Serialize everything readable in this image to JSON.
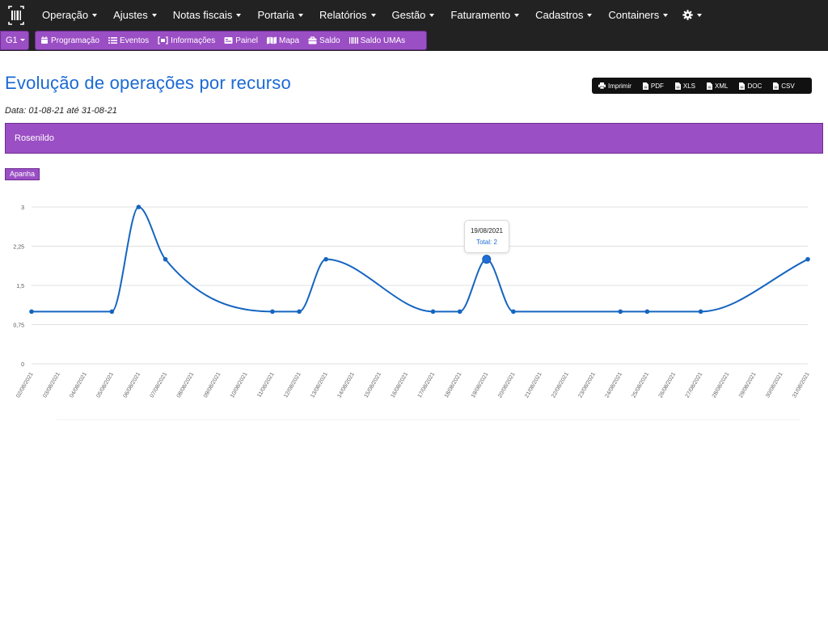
{
  "nav": {
    "items": [
      {
        "label": "Operação",
        "dropdown": true
      },
      {
        "label": "Ajustes",
        "dropdown": true
      },
      {
        "label": "Notas fiscais",
        "dropdown": true
      },
      {
        "label": "Portaria",
        "dropdown": true
      },
      {
        "label": "Relatórios",
        "dropdown": true
      },
      {
        "label": "Gestão",
        "dropdown": true
      },
      {
        "label": "Faturamento",
        "dropdown": true
      },
      {
        "label": "Cadastros",
        "dropdown": true
      },
      {
        "label": "Containers",
        "dropdown": true
      }
    ],
    "settings_icon": "gear-icon"
  },
  "subnav": {
    "unit_label": "G1",
    "items": [
      {
        "label": "Programação",
        "icon": "calendar-icon"
      },
      {
        "label": "Eventos",
        "icon": "list-icon"
      },
      {
        "label": "Informações",
        "icon": "info-frame-icon"
      },
      {
        "label": "Painel",
        "icon": "panel-icon"
      },
      {
        "label": "Mapa",
        "icon": "map-icon"
      },
      {
        "label": "Saldo",
        "icon": "briefcase-icon"
      },
      {
        "label": "Saldo UMAs",
        "icon": "barcode-icon"
      }
    ]
  },
  "page": {
    "title": "Evolução de operações por recurso",
    "date_range": "Data: 01-08-21 até 31-08-21",
    "resource_name": "Rosenildo",
    "activity_label": "Apanha"
  },
  "export": [
    {
      "label": "Imprimir",
      "icon": "printer-icon"
    },
    {
      "label": "PDF",
      "icon": "file-icon"
    },
    {
      "label": "XLS",
      "icon": "file-icon"
    },
    {
      "label": "XML",
      "icon": "file-icon"
    },
    {
      "label": "DOC",
      "icon": "file-icon"
    },
    {
      "label": "CSV",
      "icon": "file-icon"
    }
  ],
  "tooltip": {
    "date": "19/08/2021",
    "total": "Total: 2"
  },
  "colors": {
    "nav_bg": "#222222",
    "accent_purple": "#9b4fc4",
    "title_blue": "#1b6ad3",
    "series_line": "#1565c0",
    "grid": "#e0e0e0"
  },
  "chart_data": {
    "type": "line",
    "y_ticks": [
      "3",
      "2,25",
      "1,5",
      "0,75",
      "0"
    ],
    "ylim": [
      0,
      3
    ],
    "x": [
      "02/08/2021",
      "03/08/2021",
      "04/08/2021",
      "05/08/2021",
      "06/08/2021",
      "07/08/2021",
      "08/08/2021",
      "09/08/2021",
      "10/08/2021",
      "11/08/2021",
      "12/08/2021",
      "13/08/2021",
      "14/08/2021",
      "15/08/2021",
      "16/08/2021",
      "17/08/2021",
      "18/08/2021",
      "19/08/2021",
      "20/08/2021",
      "21/08/2021",
      "22/08/2021",
      "23/08/2021",
      "24/08/2021",
      "25/08/2021",
      "26/08/2021",
      "27/08/2021",
      "28/08/2021",
      "29/08/2021",
      "30/08/2021",
      "31/08/2021"
    ],
    "points": [
      {
        "x": "02/08/2021",
        "y": 1
      },
      {
        "x": "05/08/2021",
        "y": 1
      },
      {
        "x": "06/08/2021",
        "y": 3
      },
      {
        "x": "07/08/2021",
        "y": 2
      },
      {
        "x": "11/08/2021",
        "y": 1
      },
      {
        "x": "12/08/2021",
        "y": 1
      },
      {
        "x": "13/08/2021",
        "y": 2
      },
      {
        "x": "17/08/2021",
        "y": 1
      },
      {
        "x": "18/08/2021",
        "y": 1
      },
      {
        "x": "19/08/2021",
        "y": 2
      },
      {
        "x": "20/08/2021",
        "y": 1
      },
      {
        "x": "24/08/2021",
        "y": 1
      },
      {
        "x": "25/08/2021",
        "y": 1
      },
      {
        "x": "27/08/2021",
        "y": 1
      },
      {
        "x": "31/08/2021",
        "y": 2
      }
    ],
    "highlighted": "19/08/2021",
    "grid": true
  }
}
